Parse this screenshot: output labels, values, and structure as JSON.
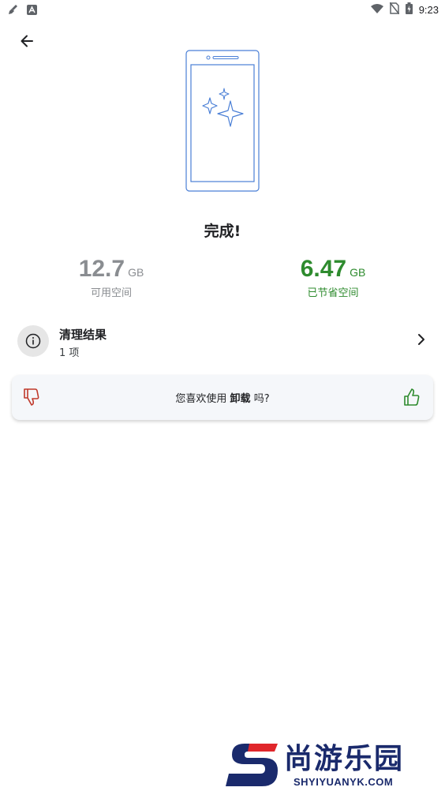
{
  "status_bar": {
    "time": "9:23",
    "left_icons": [
      "broom-icon",
      "text-a-icon"
    ],
    "right_icons": [
      "wifi-icon",
      "no-sim-icon",
      "battery-icon"
    ]
  },
  "header": {
    "back_icon": "arrow-left-icon"
  },
  "main": {
    "title": "完成!",
    "stats": {
      "available": {
        "value": "12.7",
        "unit": "GB",
        "label": "可用空间",
        "color": "#8a8d91"
      },
      "saved": {
        "value": "6.47",
        "unit": "GB",
        "label": "已节省空间",
        "color": "#2e8b2e"
      }
    },
    "result_row": {
      "title": "清理结果",
      "subtitle": "1 项",
      "icon": "info-icon"
    },
    "feedback": {
      "prefix": "您喜欢使用",
      "app_name": "卸载",
      "suffix": "吗?",
      "dislike_color": "#c0392b",
      "like_color": "#2e8b2e"
    }
  },
  "watermark": {
    "cn": "尚游乐园",
    "en": "SHYIYUANYK.COM"
  },
  "colors": {
    "accent_green": "#2e8b2e",
    "illustration_blue": "#4a7fd6",
    "watermark_navy": "#1a2a6c",
    "watermark_red": "#e0262b"
  }
}
